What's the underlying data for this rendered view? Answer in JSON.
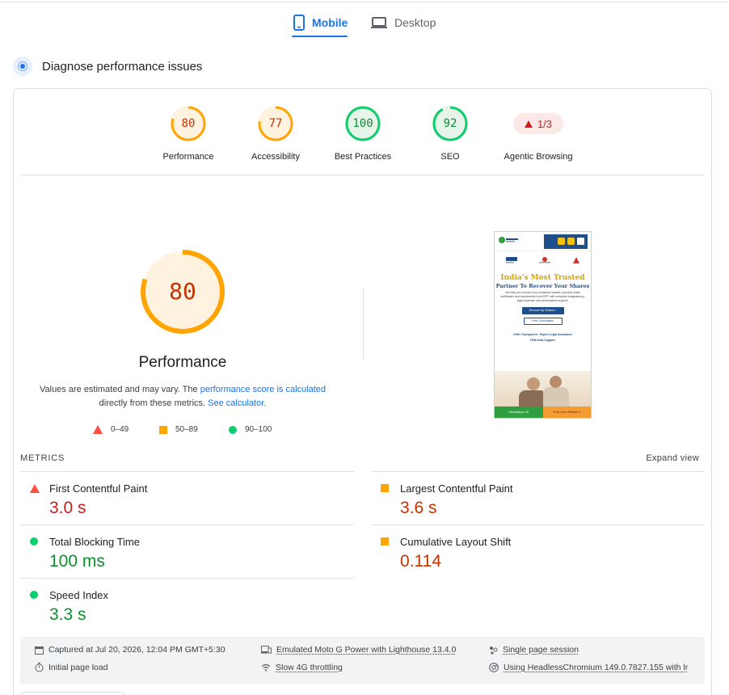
{
  "tabs": [
    {
      "label": "Mobile",
      "icon": "phone-icon",
      "active": true
    },
    {
      "label": "Desktop",
      "icon": "laptop-icon",
      "active": false
    }
  ],
  "diagnose": {
    "title": "Diagnose performance issues"
  },
  "scores": [
    {
      "label": "Performance",
      "value": "80",
      "fraction": 0.8,
      "status": "average",
      "color": "#ffa400",
      "text_color": "#c33300"
    },
    {
      "label": "Accessibility",
      "value": "77",
      "fraction": 0.77,
      "status": "average",
      "color": "#ffa400",
      "text_color": "#c33300"
    },
    {
      "label": "Best Practices",
      "value": "100",
      "fraction": 1.0,
      "status": "pass",
      "color": "#0cce6b",
      "text_color": "#0d8f2f"
    },
    {
      "label": "SEO",
      "value": "92",
      "fraction": 0.92,
      "status": "pass",
      "color": "#0cce6b",
      "text_color": "#0d8f2f"
    },
    {
      "label": "Agentic Browsing",
      "value": "1/3",
      "status": "fail",
      "color": "#c5221f"
    }
  ],
  "performance": {
    "value": "80",
    "fraction": 0.8,
    "title": "Performance",
    "note_prefix": "Values are estimated and may vary. The ",
    "note_link1": "performance score is calculated",
    "note_mid": " directly from these metrics. ",
    "note_link2": "See calculator."
  },
  "legend": [
    {
      "range": "0–49",
      "shape": "triangle",
      "color": "#ff4e42"
    },
    {
      "range": "50–89",
      "shape": "square",
      "color": "#ffa400"
    },
    {
      "range": "90–100",
      "shape": "circle",
      "color": "#0cce6b"
    }
  ],
  "screenshot": {
    "heading": "India's Most Trusted",
    "subheading": "Partner To Recover Your Shares",
    "body": "We help you recover your unclaimed shares, physical share certificates and investments from IEPF with complete transparency, legal expertise and personalized support.",
    "cta_primary": "Recover My Shares »",
    "cta_secondary": "Free Consultation",
    "badge1": "100% Transparent · Expert Legal Assistance",
    "badge2": "PAN India Support",
    "footer_left": "WhatsApp Us",
    "footer_right": "Find Your Shares »"
  },
  "metrics": {
    "heading": "METRICS",
    "expand_label": "Expand view",
    "items": [
      {
        "label": "First Contentful Paint",
        "value": "3.0 s",
        "status": "fail"
      },
      {
        "label": "Largest Contentful Paint",
        "value": "3.6 s",
        "status": "average"
      },
      {
        "label": "Total Blocking Time",
        "value": "100 ms",
        "status": "pass"
      },
      {
        "label": "Cumulative Layout Shift",
        "value": "0.114",
        "status": "average"
      },
      {
        "label": "Speed Index",
        "value": "3.3 s",
        "status": "pass"
      }
    ]
  },
  "info": {
    "captured": "Captured at Jul 20, 2026, 12:04 PM GMT+5:30",
    "initial_load": "Initial page load",
    "device": "Emulated Moto G Power with Lighthouse 13.4.0",
    "throttling": "Slow 4G throttling",
    "session": "Single page session",
    "browser": "Using HeadlessChromium 149.0.7827.155 with lr"
  }
}
